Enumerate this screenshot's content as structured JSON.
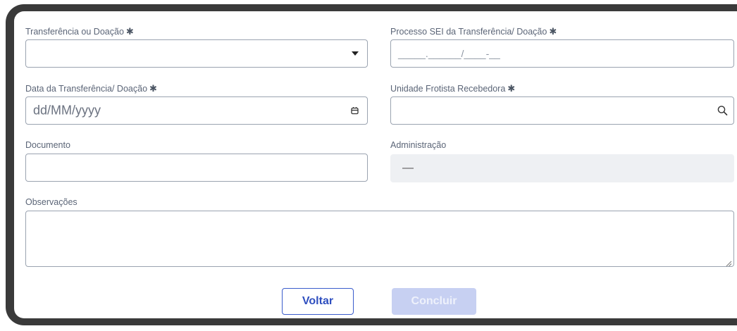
{
  "form": {
    "transferencia": {
      "label": "Transferência ou Doação",
      "required_mark": "✱",
      "value": "",
      "icon": "caret-down-icon"
    },
    "processo_sei": {
      "label": "Processo SEI da Transferência/ Doação",
      "required_mark": "✱",
      "placeholder": "_____.______/____-__"
    },
    "data": {
      "label": "Data da Transferência/ Doação",
      "required_mark": "✱",
      "placeholder": "dd/MM/yyyy",
      "icon": "calendar-icon"
    },
    "unidade": {
      "label": "Unidade Frotista Recebedora",
      "required_mark": "✱",
      "value": "",
      "icon": "search-icon"
    },
    "documento": {
      "label": "Documento",
      "value": ""
    },
    "administracao": {
      "label": "Administração",
      "value": "—"
    },
    "observacoes": {
      "label": "Observações",
      "value": ""
    }
  },
  "actions": {
    "voltar_label": "Voltar",
    "concluir_label": "Concluir",
    "concluir_disabled": true
  },
  "colors": {
    "primary": "#2f4fbf",
    "disabled": "#c7d0f2",
    "border": "#9aa3b0",
    "readonly_bg": "#eef0f3"
  }
}
